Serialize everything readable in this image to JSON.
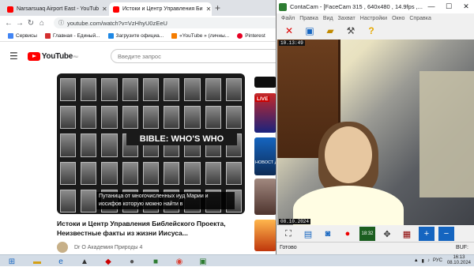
{
  "tabs": [
    {
      "label": "Narsarsuaq Airport East - YouTub",
      "icon_color": "#ff0000"
    },
    {
      "label": "Истоки и Центр Управления Би",
      "icon_color": "#ff0000"
    }
  ],
  "toolbar": {
    "url": "youtube.com/watch?v=VzHhyU0zEeU"
  },
  "bookmarks": [
    {
      "label": "Сервисы",
      "color": "#4285f4"
    },
    {
      "label": "Главная - Единый...",
      "color": "#d32f2f"
    },
    {
      "label": "Загрузите официа...",
      "color": "#1e88e5"
    },
    {
      "label": "«YouTube » (личны...",
      "color": "#f57c00"
    },
    {
      "label": "Pinterest",
      "color": "#e60023"
    }
  ],
  "youtube": {
    "logo": "YouTube",
    "region": "RU",
    "search_placeholder": "Введите запрос",
    "video_overlay_title": "BIBLE: WHO'S WHO",
    "subtitle": "Путаница от многочисленных иуд Марии и иосифов которую можно найти в",
    "title": "Истоки и Центр Управления Библейского Проекта, Неизвестные факты из жизни Иисуса...",
    "channel": "Dr O Академия Природы 4",
    "side_live": "LIVE",
    "side_news": "НОВОСТ ДНЯ"
  },
  "contacam": {
    "title": "ContaCam - [FaceCam 315 , 640x480 , 14.9fps ,...",
    "menu": [
      "Файл",
      "Правка",
      "Вид",
      "Захват",
      "Настройки",
      "Окно",
      "Справка"
    ],
    "timestamp_top": "10.13:49",
    "timestamp_bottom": "08.10.2024",
    "status_left": "Готово",
    "status_right": "BUF:"
  },
  "taskbar": {
    "lang": "РУС",
    "time": "16:13",
    "date": "08.10.2024"
  }
}
